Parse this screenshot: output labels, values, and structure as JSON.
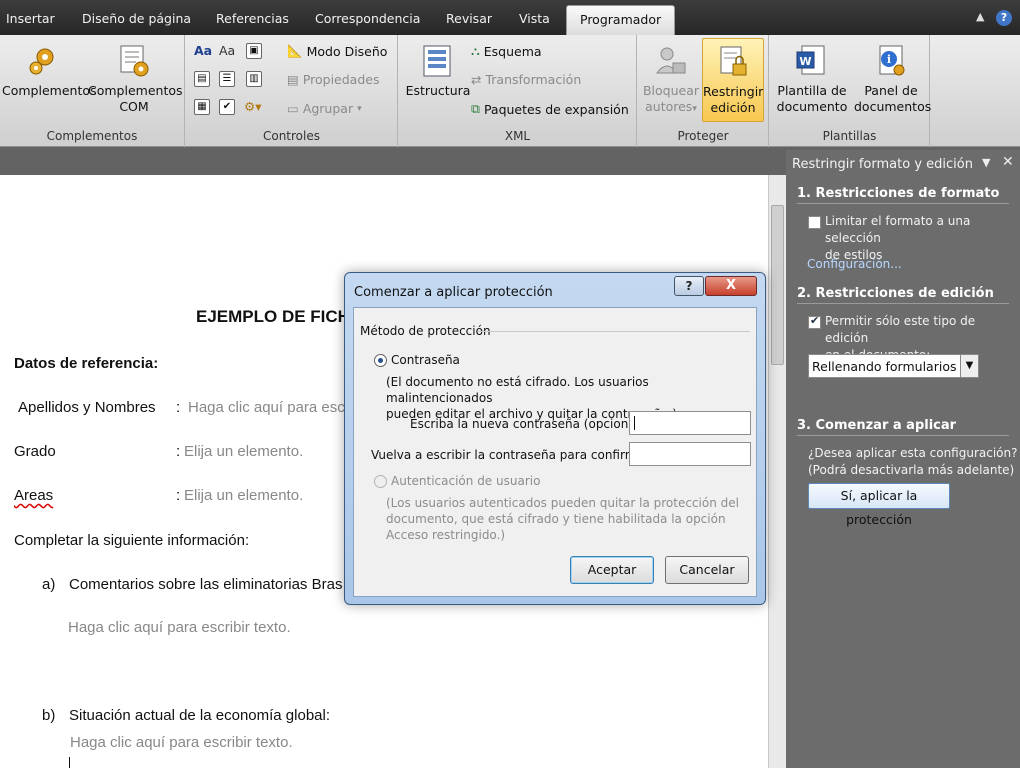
{
  "tabs": [
    "Insertar",
    "Diseño de página",
    "Referencias",
    "Correspondencia",
    "Revisar",
    "Vista",
    "Programador"
  ],
  "ribbon": {
    "groups": {
      "complementos": {
        "label": "Complementos",
        "complementos": "Complementos",
        "complementos_com_1": "Complementos",
        "complementos_com_2": "COM"
      },
      "controles": {
        "label": "Controles",
        "modo_diseno": "Modo Diseño",
        "propiedades": "Propiedades",
        "agrupar": "Agrupar"
      },
      "xml": {
        "label": "XML",
        "estructura": "Estructura",
        "esquema": "Esquema",
        "transformacion": "Transformación",
        "paquetes": "Paquetes de expansión"
      },
      "proteger": {
        "label": "Proteger",
        "bloquear_1": "Bloquear",
        "bloquear_2": "autores",
        "restringir_1": "Restringir",
        "restringir_2": "edición"
      },
      "plantillas": {
        "label": "Plantillas",
        "plantilla_1": "Plantilla de",
        "plantilla_2": "documento",
        "panel_1": "Panel de",
        "panel_2": "documentos"
      }
    }
  },
  "document": {
    "title": "EJEMPLO DE FICH",
    "datos_ref": "Datos de referencia:",
    "apellidos_label": "Apellidos y Nombres",
    "apellidos_value": "Haga clic aquí para escr",
    "grado_label": "Grado",
    "grado_value": "Elija un elemento.",
    "areas_label": "Areas",
    "areas_value": "Elija un elemento.",
    "colon": ":",
    "completar": "Completar la siguiente información:",
    "item_a_marker": "a)",
    "item_a_text": "Comentarios sobre las eliminatorias Bras",
    "item_a_placeholder": "Haga clic aquí para escribir texto.",
    "item_b_marker": "b)",
    "item_b_text": "Situación actual de la economía global:",
    "item_b_placeholder": "Haga clic aquí para escribir texto."
  },
  "pane": {
    "title": "Restringir formato y edición",
    "sec1_title": "1. Restricciones de formato",
    "sec1_check_1": "Limitar el formato a una selección",
    "sec1_check_2": "de estilos",
    "sec1_link": "Configuración...",
    "sec2_title": "2. Restricciones de edición",
    "sec2_check_1": "Permitir sólo este tipo de edición",
    "sec2_check_2": "en el documento:",
    "sec2_select": "Rellenando formularios",
    "sec3_title": "3. Comenzar a aplicar",
    "sec3_text_1": "¿Desea aplicar esta configuración?",
    "sec3_text_2": "(Podrá desactivarla más adelante)",
    "apply_button": "Sí, aplicar la protección"
  },
  "dialog": {
    "title": "Comenzar a aplicar protección",
    "help": "?",
    "close": "X",
    "method_label": "Método de protección",
    "password_option": "Contraseña",
    "password_note_1": "(El documento no está cifrado. Los usuarios malintencionados",
    "password_note_2": "pueden editar el archivo y quitar la contraseña.)",
    "new_password_label": "Escriba la nueva contraseña (opcional):",
    "confirm_password_label": "Vuelva a escribir la contraseña para confirmar:",
    "auth_option": "Autenticación de usuario",
    "auth_note_1": "(Los usuarios autenticados pueden quitar la protección del",
    "auth_note_2": "documento, que está cifrado y tiene habilitada la opción",
    "auth_note_3": "Acceso restringido.)",
    "ok": "Aceptar",
    "cancel": "Cancelar"
  },
  "colors": {
    "tabbar": "#262626",
    "ribbon": "#dcdcdc",
    "pane": "#6c6c6c",
    "dialog_frame": "#a9c6e8",
    "highlight": "#f7c850"
  }
}
